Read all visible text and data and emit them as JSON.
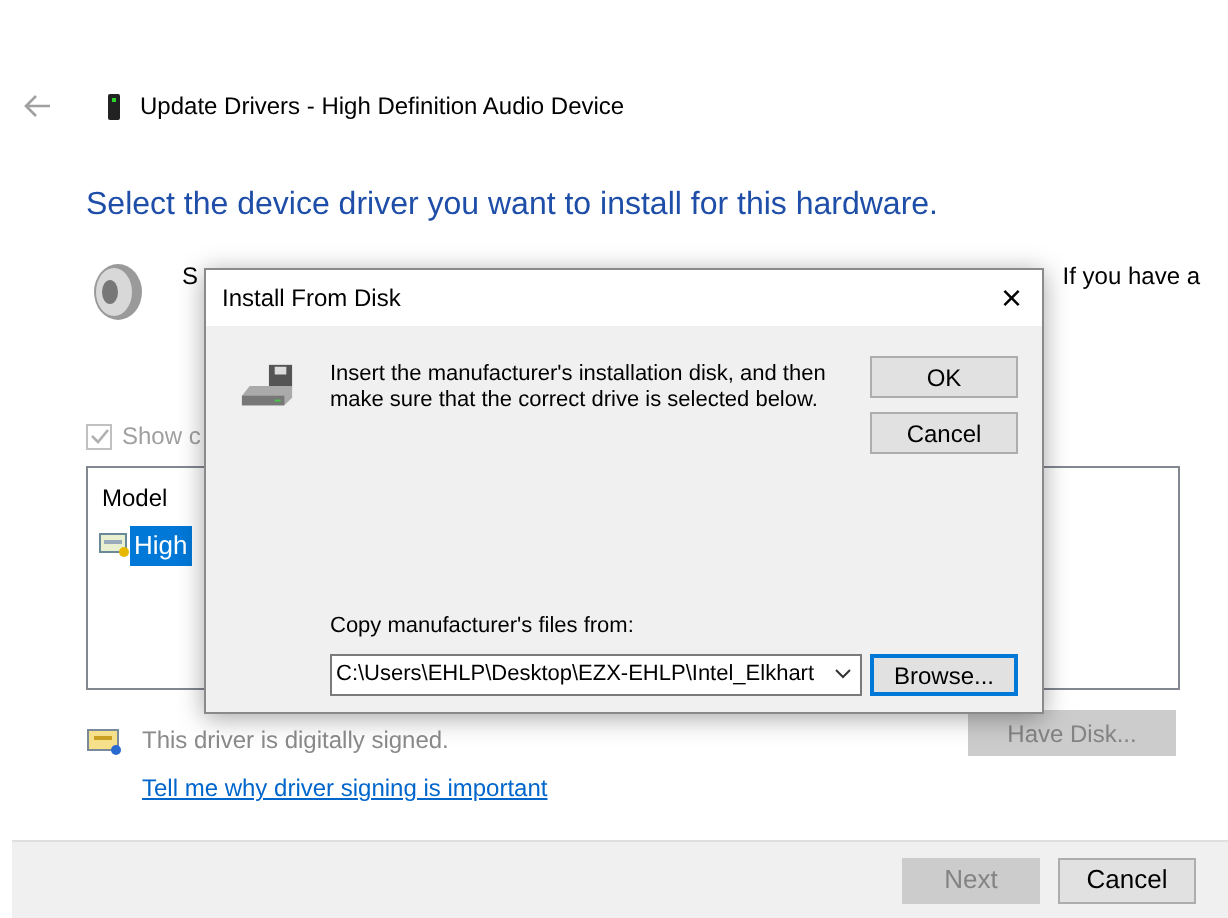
{
  "window": {
    "title": "Update Drivers - High Definition Audio Device"
  },
  "heading": "Select the device driver you want to install for this hardware.",
  "description_start": "S",
  "description_end": "If you have a",
  "compatible_checkbox": {
    "label": "Show c",
    "checked": true,
    "disabled": true
  },
  "model_list": {
    "header": "Model",
    "items": [
      {
        "label": "High",
        "selected": true
      }
    ]
  },
  "signed_text": "This driver is digitally signed.",
  "signing_link": "Tell me why driver signing is important",
  "have_disk_button": {
    "label": "Have Disk...",
    "disabled": true
  },
  "footer_buttons": [
    {
      "label": "Next",
      "disabled": true
    },
    {
      "label": "Cancel",
      "disabled": false
    }
  ],
  "dialog": {
    "title": "Install From Disk",
    "close": "×",
    "message": "Insert the manufacturer's installation disk, and then make sure that the correct drive is selected below.",
    "buttons": [
      {
        "label": "OK",
        "focused": false
      },
      {
        "label": "Cancel",
        "focused": false
      }
    ],
    "copy_label": "Copy manufacturer's files from:",
    "path": "C:\\Users\\EHLP\\Desktop\\EZX-EHLP\\Intel_Elkhart",
    "browse": {
      "label": "Browse...",
      "focused": true
    }
  }
}
